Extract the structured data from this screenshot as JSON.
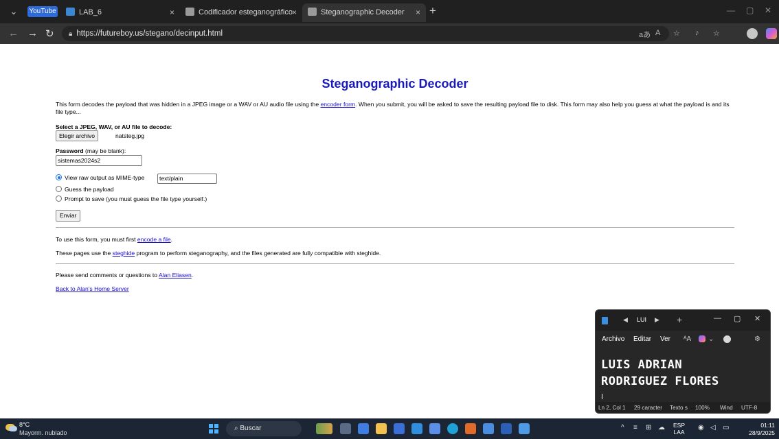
{
  "browser": {
    "tab_group_label": "YouTube",
    "tabs": [
      {
        "label": "LAB_6",
        "active": false
      },
      {
        "label": "Codificador esteganográfico",
        "active": false
      },
      {
        "label": "Steganographic Decoder",
        "active": true
      }
    ],
    "url": "https://futureboy.us/stegano/decinput.html",
    "close_glyph": "×",
    "new_tab_glyph": "+"
  },
  "page": {
    "title": "Steganographic Decoder",
    "intro_before_link": "This form decodes the payload that was hidden in a JPEG image or a WAV or AU audio file using the ",
    "intro_link": "encoder form",
    "intro_after_link": ". When you submit, you will be asked to save the resulting payload file to disk. This form may also help you guess at what the payload is and its file type...",
    "file_label": "Select a JPEG, WAV, or AU file to decode:",
    "file_button": "Elegir archivo",
    "file_name": "natsteg.jpg",
    "password_label": "Password",
    "password_hint": " (may be blank):",
    "password_value": "sistemas2024s2",
    "options": [
      {
        "label": "View raw output as MIME-type",
        "selected": true
      },
      {
        "label": "Guess the payload",
        "selected": false
      },
      {
        "label": "Prompt to save (you must guess the file type yourself.)",
        "selected": false
      }
    ],
    "mime_value": "text/plain",
    "submit_label": "Enviar",
    "use_before": "To use this form, you must first ",
    "use_link": "encode a file",
    "use_after": ".",
    "steg_before": "These pages use the ",
    "steg_link": "steghide",
    "steg_after": " program to perform steganography, and the files generated are fully compatible with steghide.",
    "comments_before": "Please send comments or questions to ",
    "comments_link": "Alan Eliasen",
    "comments_after": ".",
    "home_link": "Back to Alan's Home Server"
  },
  "notepad": {
    "tab_name": "LUI",
    "menu": [
      "Archivo",
      "Editar",
      "Ver"
    ],
    "text_line1": "LUIS ADRIAN",
    "text_line2": "RODRIGUEZ FLORES",
    "status": [
      "Ln 2, Col 1",
      "29 caracter",
      "Texto s",
      "100%",
      "Wind",
      "UTF-8"
    ]
  },
  "taskbar": {
    "temperature": "8°C",
    "weather": "Mayorm. nublado",
    "search_placeholder": "Buscar",
    "lang_top": "ESP",
    "lang_bottom": "LAA",
    "time": "01:11",
    "date": "28/9/2025"
  },
  "colors": {
    "title_blue": "#1a1ab8",
    "link_blue": "#1a0dcc",
    "tab_group": "#2f6ad9",
    "taskbar": "#1c2533"
  }
}
